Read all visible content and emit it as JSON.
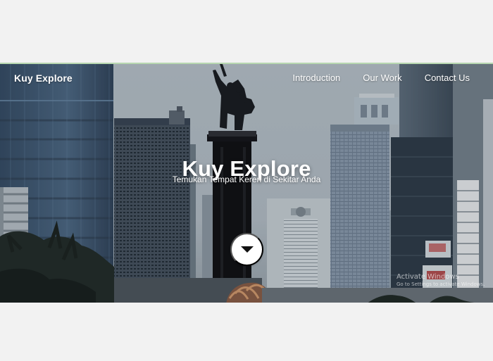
{
  "page": {
    "background_color": "#f2f2f2",
    "hero_top_border": "#b7d7b0"
  },
  "navbar": {
    "brand": "Kuy Explore",
    "links": [
      {
        "label": "Introduction"
      },
      {
        "label": "Our Work"
      },
      {
        "label": "Contact Us"
      }
    ]
  },
  "hero": {
    "title": "Kuy Explore",
    "subtitle": "Temukan Tempat Keren di Sekitar Anda",
    "scroll_icon": "chevron-down-icon"
  },
  "system_watermark": {
    "title": "Activate Windows",
    "subtitle": "Go to Settings to activate Windows."
  }
}
